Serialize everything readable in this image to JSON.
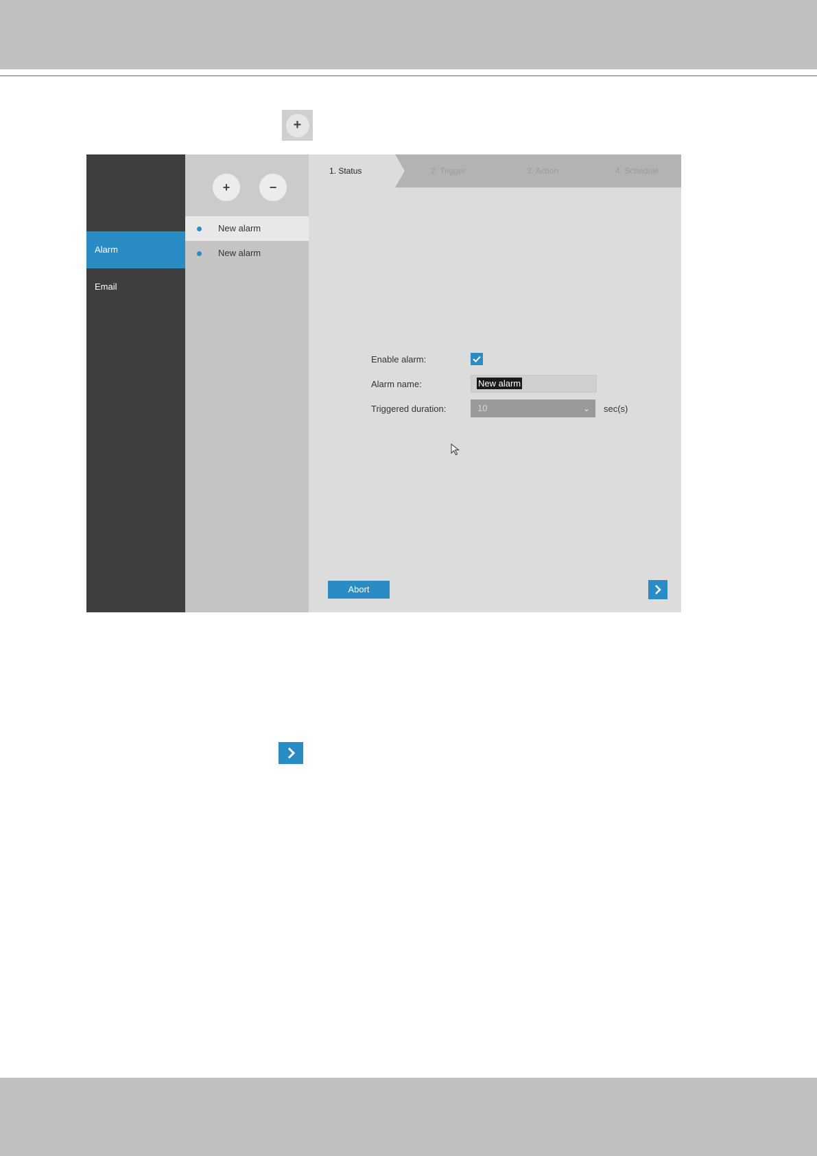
{
  "accent_color": "#2a8cc4",
  "sidebar": {
    "items": [
      {
        "label": "Alarm",
        "active": true
      },
      {
        "label": "Email",
        "active": false
      }
    ]
  },
  "list": {
    "add_icon": "plus-icon",
    "remove_icon": "minus-icon",
    "items": [
      {
        "label": "New alarm",
        "selected": true
      },
      {
        "label": "New alarm",
        "selected": false
      }
    ]
  },
  "steps": [
    {
      "label": "1. Status",
      "active": true
    },
    {
      "label": "2. Trigger",
      "active": false
    },
    {
      "label": "3. Action",
      "active": false
    },
    {
      "label": "4. Schedule",
      "active": false
    }
  ],
  "form": {
    "enable_label": "Enable alarm:",
    "enable_checked": true,
    "name_label": "Alarm name:",
    "name_value": "New alarm",
    "duration_label": "Triggered duration:",
    "duration_value": "10",
    "duration_unit": "sec(s)"
  },
  "footer": {
    "abort_label": "Abort",
    "next_icon": "chevron-right-icon"
  }
}
